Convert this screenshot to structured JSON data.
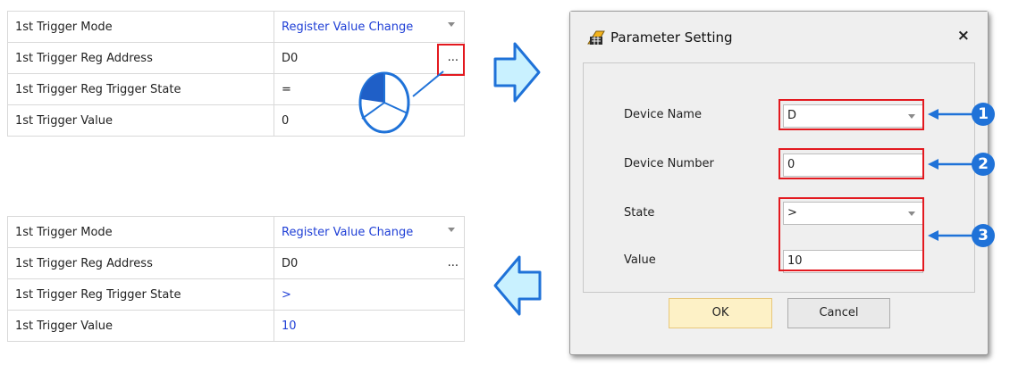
{
  "top_grid": {
    "rows": [
      {
        "name": "1st Trigger Mode",
        "value": "Register Value Change"
      },
      {
        "name": "1st Trigger Reg Address",
        "value": "D0"
      },
      {
        "name": "1st Trigger Reg Trigger State",
        "value": "="
      },
      {
        "name": "1st Trigger Value",
        "value": "0"
      }
    ],
    "ellipsis": "..."
  },
  "bottom_grid": {
    "rows": [
      {
        "name": "1st Trigger Mode",
        "value": "Register Value Change"
      },
      {
        "name": "1st Trigger Reg Address",
        "value": "D0"
      },
      {
        "name": "1st Trigger Reg Trigger State",
        "value": ">"
      },
      {
        "name": "1st Trigger Value",
        "value": "10"
      }
    ],
    "ellipsis": "..."
  },
  "dialog": {
    "title": "Parameter Setting",
    "close": "×",
    "device_name_label": "Device Name",
    "device_name_value": "D",
    "device_number_label": "Device Number",
    "device_number_value": "0",
    "state_label": "State",
    "state_value": ">",
    "value_label": "Value",
    "value_value": "10",
    "ok_label": "OK",
    "cancel_label": "Cancel"
  },
  "callouts": [
    "1",
    "2",
    "3"
  ],
  "colors": {
    "highlight": "#e3191f",
    "callout": "#1f72d8",
    "arrow_fill": "#c9f1ff",
    "arrow_stroke": "#1f72d8",
    "link_value": "#1f3fd6"
  }
}
